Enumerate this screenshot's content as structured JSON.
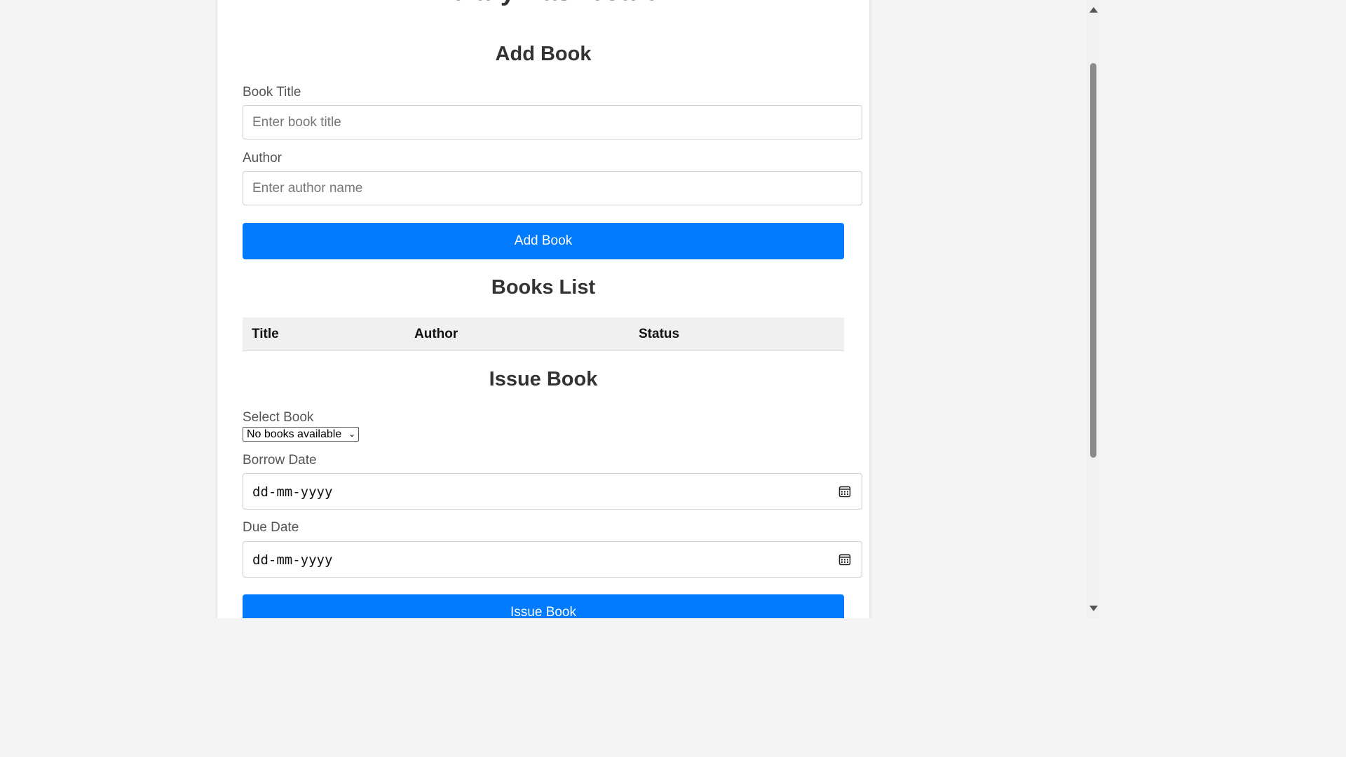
{
  "header": {
    "title": "Library Dashboard"
  },
  "add_book": {
    "heading": "Add Book",
    "title_label": "Book Title",
    "title_placeholder": "Enter book title",
    "title_value": "",
    "author_label": "Author",
    "author_placeholder": "Enter author name",
    "author_value": "",
    "button_label": "Add Book"
  },
  "books_list": {
    "heading": "Books List",
    "columns": [
      "Title",
      "Author",
      "Status"
    ],
    "rows": []
  },
  "issue_book": {
    "heading": "Issue Book",
    "select_label": "Select Book",
    "select_value": "No books available",
    "borrow_label": "Borrow Date",
    "borrow_value": "dd-mm-yyyy",
    "due_label": "Due Date",
    "due_value": "dd-mm-yyyy",
    "button_label": "Issue Book"
  },
  "icons": {
    "calendar": "calendar-icon",
    "chevron": "chevron-down-icon"
  },
  "colors": {
    "accent": "#007bff",
    "background": "#f4f4f4",
    "card": "#ffffff",
    "table_header": "#f0f0f0"
  }
}
